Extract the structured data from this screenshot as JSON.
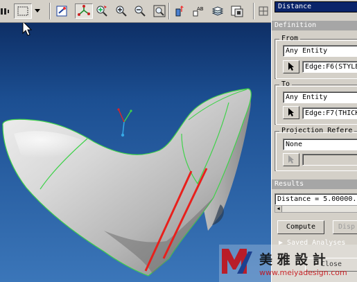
{
  "panel": {
    "title": "Distance",
    "definition_header": "Definition",
    "from": {
      "label": "From",
      "filter": "Any Entity",
      "selection": "Edge:F6(STYLE"
    },
    "to": {
      "label": "To",
      "filter": "Any Entity",
      "selection": "Edge:F7(THICK"
    },
    "projection": {
      "label": "Projection Refere",
      "value": "None"
    },
    "results_header": "Results",
    "result_text": "Distance = 5.00000.",
    "compute_label": "Compute",
    "display_label": "Disp",
    "saved_analyses_label": "Saved Analyses",
    "close_label": "Close"
  },
  "toolbar": {
    "icons": [
      "datum-icon",
      "select-box-icon",
      "dropdown-arrow-icon",
      "spin-center-icon",
      "orient-icon",
      "zoom-in-icon",
      "zoom-out-icon",
      "refit-icon",
      "view-manager-icon",
      "named-view-icon",
      "layers-icon",
      "model-tree-icon",
      "repaint-icon"
    ]
  },
  "watermark": {
    "brand": "美 雅 設 計",
    "url": "www.meiyadesign.com"
  },
  "colors": {
    "title_bar": "#0a246a",
    "section_bar": "#a6a6a6",
    "edge_highlight": "#3fd24a",
    "measure_edge": "#e8201c"
  }
}
